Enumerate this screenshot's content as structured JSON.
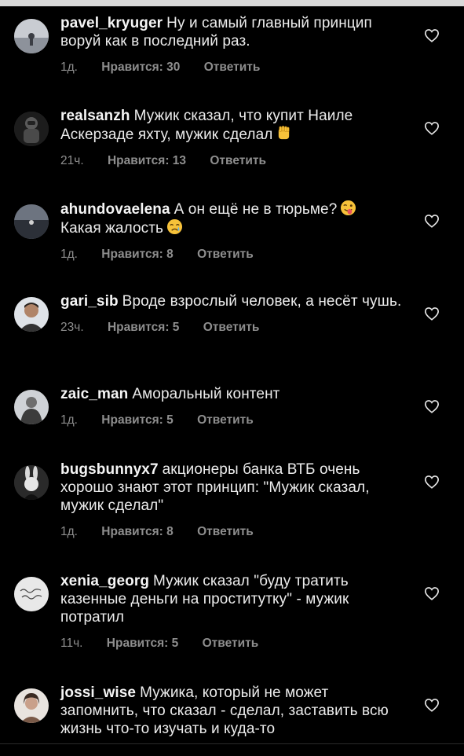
{
  "comments": [
    {
      "username": "pavel_kryuger",
      "text": "Ну и самый главный принцип воруй как в последний раз.",
      "time": "1д.",
      "likes": "Нравится: 30",
      "reply": "Ответить",
      "avatar_icon": "avatar-landscape-icon"
    },
    {
      "username": "realsanzh",
      "text": "Мужик сказал, что купит Наиле Аскерзаде яхту, мужик сделал",
      "emoji": "raised-fist-emoji",
      "time": "21ч.",
      "likes": "Нравится: 13",
      "reply": "Ответить",
      "avatar_icon": "avatar-astronaut-icon"
    },
    {
      "username": "ahundovaelena",
      "text": "А он ещё не в тюрьме?",
      "emoji": "winking-tongue-emoji",
      "text2": "Какая жалость",
      "emoji2": "crying-face-emoji",
      "time": "1д.",
      "likes": "Нравится: 8",
      "reply": "Ответить",
      "avatar_icon": "avatar-landscape-icon"
    },
    {
      "username": "gari_sib",
      "text": "Вроде взрослый человек, а несёт чушь.",
      "time": "23ч.",
      "likes": "Нравится: 5",
      "reply": "Ответить",
      "avatar_icon": "avatar-person-icon"
    },
    {
      "username": "zaic_man",
      "text": "Аморальный контент",
      "time": "1д.",
      "likes": "Нравится: 5",
      "reply": "Ответить",
      "avatar_icon": "avatar-person-icon"
    },
    {
      "username": "bugsbunnyx7",
      "text": "акционеры банка ВТБ очень хорошо знают этот принцип: \"Мужик сказал, мужик сделал\"",
      "time": "1д.",
      "likes": "Нравится: 8",
      "reply": "Ответить",
      "avatar_icon": "avatar-bunny-icon"
    },
    {
      "username": "xenia_georg",
      "text": "Мужик сказал \"буду тратить казенные деньги на проститутку\" - мужик потратил",
      "time": "11ч.",
      "likes": "Нравится: 5",
      "reply": "Ответить",
      "avatar_icon": "avatar-handwriting-icon"
    },
    {
      "username": "jossi_wise",
      "text": "Мужика, который не может запомнить, что сказал - сделал, заставить всю жизнь что-то изучать и куда-то",
      "avatar_icon": "avatar-person-icon"
    }
  ],
  "colors": {
    "background": "#000000",
    "text": "#ececec",
    "meta": "#8e8e8e"
  }
}
